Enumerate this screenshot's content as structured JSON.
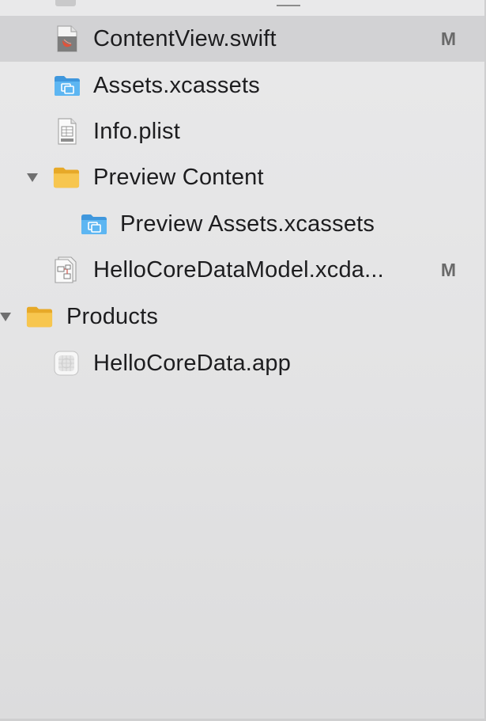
{
  "navigator": {
    "items": [
      {
        "label": "ContentView.swift",
        "icon": "swift-file-icon",
        "badge": "M",
        "selected": true
      },
      {
        "label": "Assets.xcassets",
        "icon": "asset-catalog-icon",
        "badge": ""
      },
      {
        "label": "Info.plist",
        "icon": "plist-file-icon",
        "badge": ""
      },
      {
        "label": "Preview Content",
        "icon": "folder-icon",
        "badge": "",
        "expanded": true
      },
      {
        "label": "Preview Assets.xcassets",
        "icon": "asset-catalog-icon",
        "badge": ""
      },
      {
        "label": "HelloCoreDataModel.xcda...",
        "icon": "core-data-model-icon",
        "badge": "M"
      },
      {
        "label": "Products",
        "icon": "folder-icon",
        "badge": "",
        "expanded": true
      },
      {
        "label": "HelloCoreData.app",
        "icon": "app-icon",
        "badge": ""
      }
    ],
    "colors": {
      "selection": "#d2d2d4",
      "folder": "#f5c14a",
      "asset_catalog": "#4aa8e8",
      "swift": "#e0533b"
    }
  }
}
